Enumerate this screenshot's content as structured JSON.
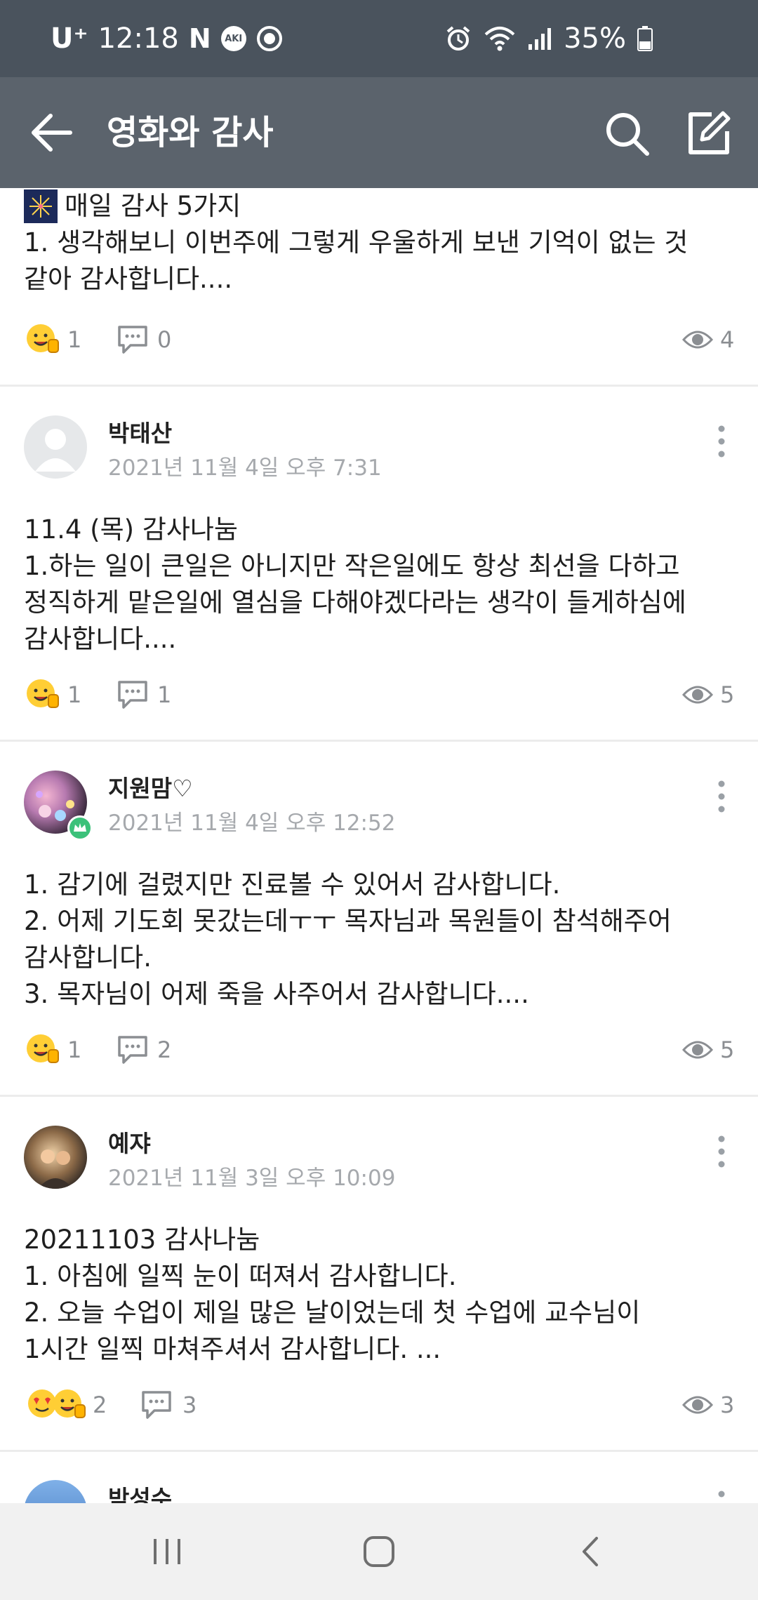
{
  "status_bar": {
    "carrier": "U⁺",
    "time": "12:18",
    "n_icon_label": "N",
    "aki_label": "AKI",
    "battery": "35%"
  },
  "app_bar": {
    "title": "영화와 감사"
  },
  "posts": [
    {
      "body": [
        "매일 감사 5가지",
        "1. 생각해보니 이번주에 그렇게 우울하게 보낸 기억이 없는 것",
        "같아 감사합니다...."
      ],
      "likes": "1",
      "comments": "0",
      "views": "4"
    },
    {
      "author": "박태산",
      "timestamp": "2021년 11월 4일 오후 7:31",
      "body": [
        "11.4 (목) 감사나눔",
        "1.하는 일이 큰일은 아니지만 작은일에도 항상 최선을 다하고",
        "정직하게 맡은일에 열심을 다해야겠다라는 생각이 들게하심에",
        "감사합니다...."
      ],
      "likes": "1",
      "comments": "1",
      "views": "5"
    },
    {
      "author": "지원맘♡",
      "timestamp": "2021년 11월 4일 오후 12:52",
      "body": [
        "1. 감기에 걸렸지만 진료볼 수 있어서 감사합니다.",
        "2. 어제 기도회 못갔는데ㅜㅜ 목자님과 목원들이 참석해주어",
        "감사합니다.",
        "3. 목자님이 어제 죽을 사주어서 감사합니다...."
      ],
      "likes": "1",
      "comments": "2",
      "views": "5"
    },
    {
      "author": "예쟈",
      "timestamp": "2021년 11월 3일 오후 10:09",
      "body": [
        "20211103 감사나눔",
        "1. 아침에 일찍 눈이 떠져서 감사합니다.",
        "2. 오늘 수업이 제일 많은 날이었는데 첫 수업에 교수님이",
        "1시간 일찍 마쳐주셔서 감사합니다. ..."
      ],
      "likes": "2",
      "comments": "3",
      "views": "3"
    },
    {
      "author": "박성수"
    }
  ],
  "colors": {
    "status_bar": "#4a535d",
    "app_bar": "#5b636c",
    "timestamp": "#a6a9ad",
    "badge": "#3cc17a",
    "nav_bar": "#f1f1f1"
  }
}
